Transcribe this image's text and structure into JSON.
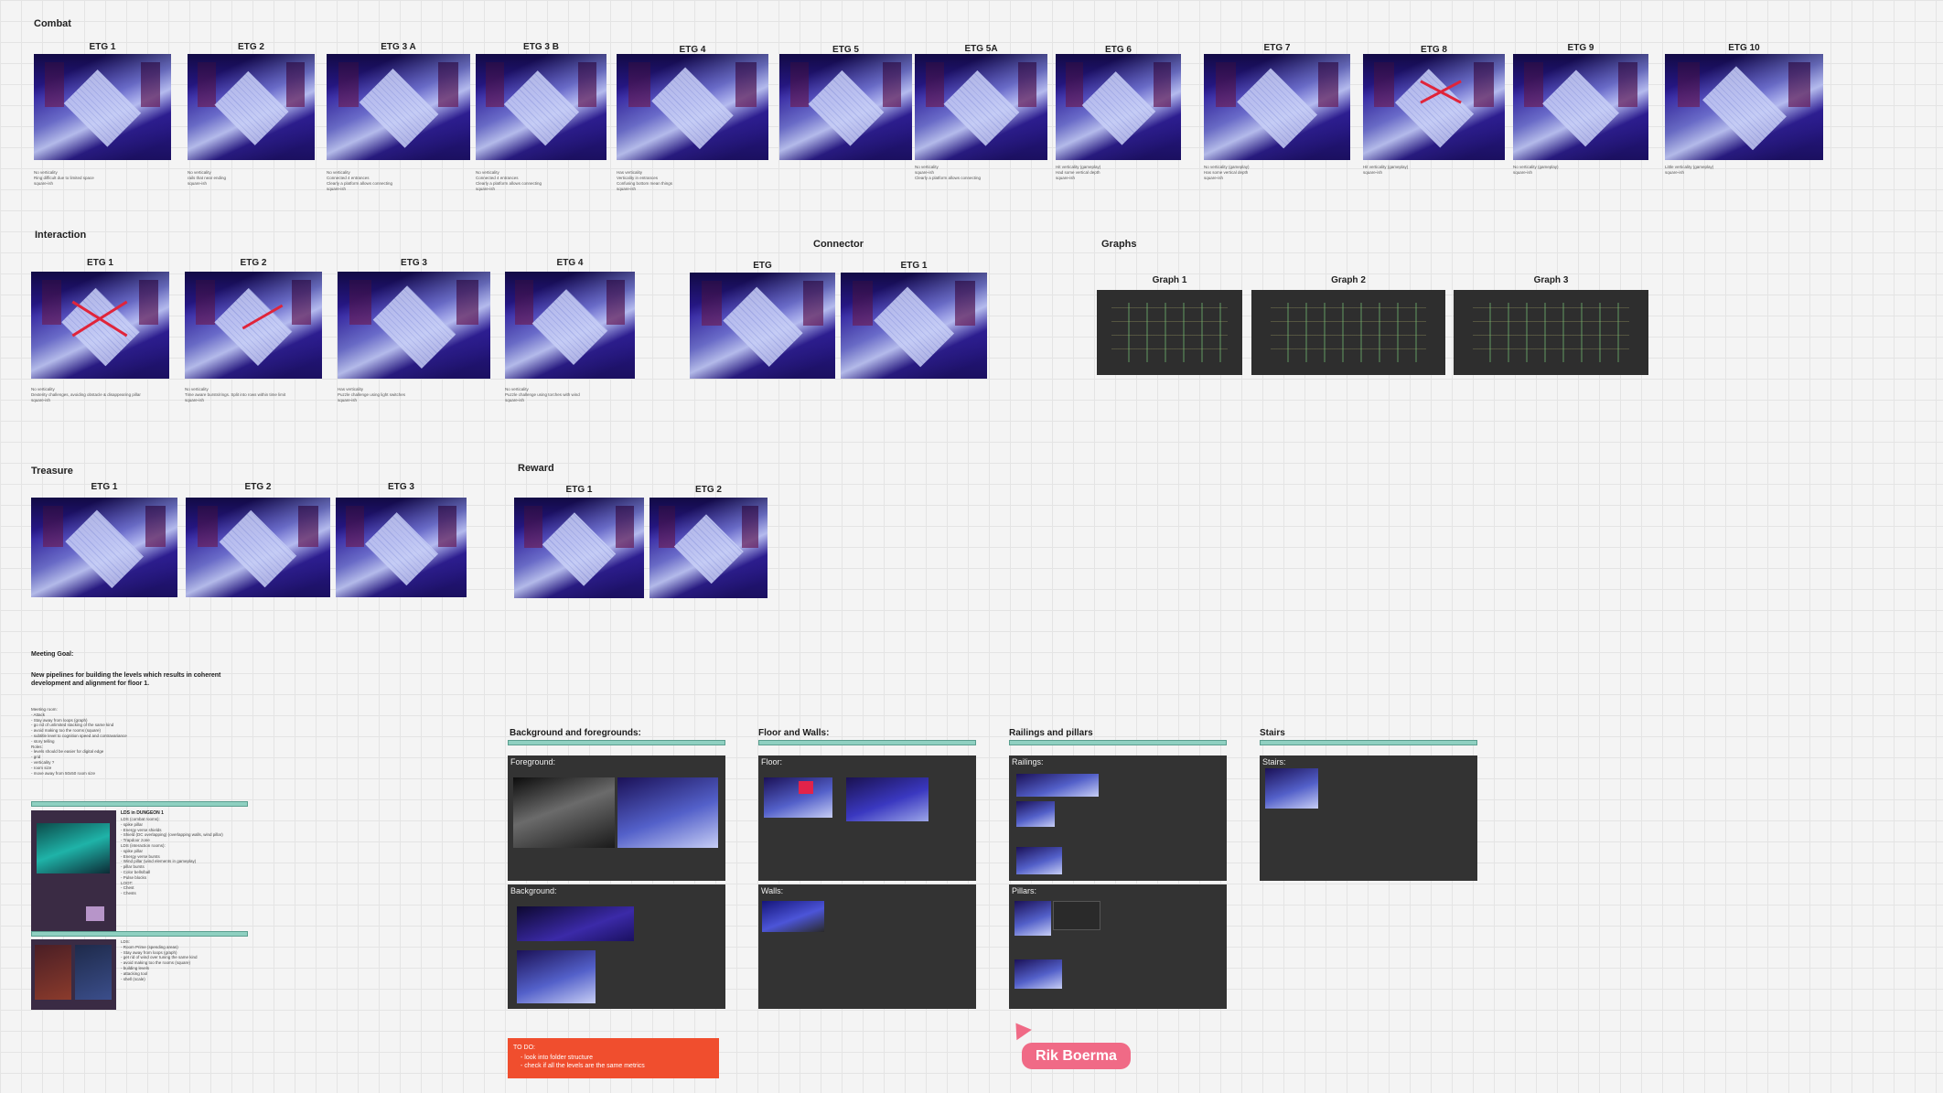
{
  "sections": {
    "combat": "Combat",
    "interaction": "Interaction",
    "treasure": "Treasure",
    "reward": "Reward",
    "connector": "Connector",
    "graphs": "Graphs"
  },
  "combat_cards": [
    {
      "title": "ETG 1",
      "caption": "No verticality\nRing difficult due to limited space\nsquare-ish"
    },
    {
      "title": "ETG 2",
      "caption": "No verticality\nrails that near ending\nsquare-ish"
    },
    {
      "title": "ETG 3 A",
      "caption": "No verticality\nConnected 4 entrances\nClearly a platform allows connecting\nsquare-ish"
    },
    {
      "title": "ETG 3 B",
      "caption": "No verticality\nConnected 4 entrances\nClearly a platform allows connecting\nsquare-ish"
    },
    {
      "title": "ETG 4",
      "caption": "Has verticality\nVerticality in entrances\nConfusing bottom mean things\nsquare-ish"
    },
    {
      "title": "ETG 5",
      "caption": ""
    },
    {
      "title": "ETG 5A",
      "caption": "No verticality\nsquare-ish\nClearly a platform allows connecting"
    },
    {
      "title": "ETG 6",
      "caption": "Hit verticality (gameplay)\nHad some vertical depth\nsquare-ish"
    },
    {
      "title": "ETG 7",
      "caption": "No verticality (gameplay)\nHas some vertical depth\nsquare-ish"
    },
    {
      "title": "ETG 8",
      "caption": "Hit verticality (gameplay)\nsquare-ish"
    },
    {
      "title": "ETG 9",
      "caption": "No verticality (gameplay)\nsquare-ish"
    },
    {
      "title": "ETG 10",
      "caption": "Little verticality (gameplay)\nsquare-ish"
    }
  ],
  "interaction_cards": [
    {
      "title": "ETG 1",
      "caption": "No verticality\nDexterity challenges, avoiding obstacle & disappearing pillar\nsquare-ish"
    },
    {
      "title": "ETG 2",
      "caption": "No verticality\nTime aware bursts/rings. Split into rows within time limit\nsquare-ish"
    },
    {
      "title": "ETG 3",
      "caption": "Has verticality\nPuzzle challenge using light switches\nsquare-ish"
    },
    {
      "title": "ETG 4",
      "caption": "No verticality\nPuzzle challenge using torches with wind\nsquare-ish"
    }
  ],
  "connector_cards": [
    {
      "title": "ETG"
    },
    {
      "title": "ETG 1"
    }
  ],
  "graph_cards": [
    {
      "title": "Graph 1"
    },
    {
      "title": "Graph 2"
    },
    {
      "title": "Graph 3"
    }
  ],
  "treasure_cards": [
    {
      "title": "ETG 1"
    },
    {
      "title": "ETG 2"
    },
    {
      "title": "ETG 3"
    }
  ],
  "reward_cards": [
    {
      "title": "ETG 1"
    },
    {
      "title": "ETG 2"
    }
  ],
  "meeting": {
    "label": "Meeting Goal:",
    "goal": "New pipelines for building the levels which results in coherent development and alignment for floor 1.",
    "notes": "Meeting room:\n- Attack\n- Stay away from loops (graph)\n- go rid of unlimited stacking of the same kind\n- avoid making too the rooms (square)\n- subtitle level to cognition speed and contravariance\n- story telling\nRoles:\n- levels should be easier for digital edge\n- grid\n- verticality ?\n- room size\n- move away from 50x50 room size",
    "doc_title": "LDS in DUNGEON 1",
    "doc_text": "LDS (combat rooms):\n- spike pillar\n- Energy verse shields\n- Shield (DC overlapping) (overlapping walls, wind pillar)\n- Trapdoor zone\nLDS (interaction rooms):\n- spike pillar\n- Energy verse bursts\n- Wind pillar (wind elements in gameplay)\n- pillar bursts\n- Color bells/ball\n- Pulse blocks\nLOOT:\n- Chest\n- Chests",
    "doc2_text": "LDS:\n- Room Prime (spending areas)\n- Stay away from loops (graph)\n- get rid of wind over tuning the same kind\n- avoid making too the rooms (square)\n- building levels\n- attacking tool\n- shell (scale)"
  },
  "panels": [
    {
      "title": "Background and foregrounds:",
      "top_label": "Foreground:",
      "bottom_label": "Background:"
    },
    {
      "title": "Floor and Walls:",
      "top_label": "Floor:",
      "bottom_label": "Walls:"
    },
    {
      "title": "Railings and pillars",
      "top_label": "Railings:",
      "bottom_label": "Pillars:"
    },
    {
      "title": "Stairs",
      "top_label": "Stairs:",
      "bottom_label": ""
    }
  ],
  "todo": {
    "title": "TO DO:",
    "items": [
      "look into folder structure",
      "check if all the levels are the same metrics"
    ]
  },
  "cursor": {
    "name": "Rik Boerma"
  },
  "colors": {
    "accent_bar": "#8fd0c1",
    "todo": "#f04e2e",
    "cursor": "#f06a86",
    "panel": "#333333"
  }
}
